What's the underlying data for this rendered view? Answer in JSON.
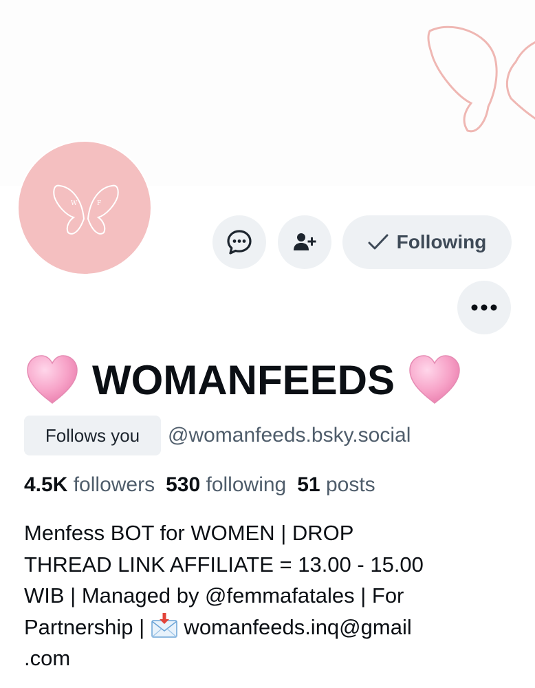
{
  "profile": {
    "display_name": "WOMANFEEDS",
    "heart_left_icon": "pink-heart-icon",
    "heart_right_icon": "pink-heart-icon",
    "follows_you_badge": "Follows you",
    "handle": "@womanfeeds.bsky.social",
    "avatar_initials": [
      "W",
      "F"
    ]
  },
  "actions": {
    "message_icon": "chat-bubble-icon",
    "add_user_icon": "person-add-icon",
    "following_label": "Following",
    "following_icon": "checkmark-icon",
    "more_icon": "ellipsis-icon"
  },
  "stats": {
    "followers_count": "4.5K",
    "followers_label": "followers",
    "following_count": "530",
    "following_label": "following",
    "posts_count": "51",
    "posts_label": "posts"
  },
  "bio": {
    "line1": "Menfess BOT for WOMEN | DROP",
    "line2": "THREAD LINK AFFILIATE = 13.00 - 15.00",
    "line3": "WIB | Managed by @femmafatales | For",
    "line4_prefix": "Partnership | ",
    "line4_email": " womanfeeds.inq@gmail",
    "line5": ".com",
    "mail_icon": "incoming-envelope-icon"
  },
  "colors": {
    "avatar_bg": "#f4bfc0",
    "button_bg": "#eef1f4",
    "muted_text": "#4f5d6b",
    "heart_pink": "#f7a3c8",
    "banner_outline": "#efb7b3"
  }
}
